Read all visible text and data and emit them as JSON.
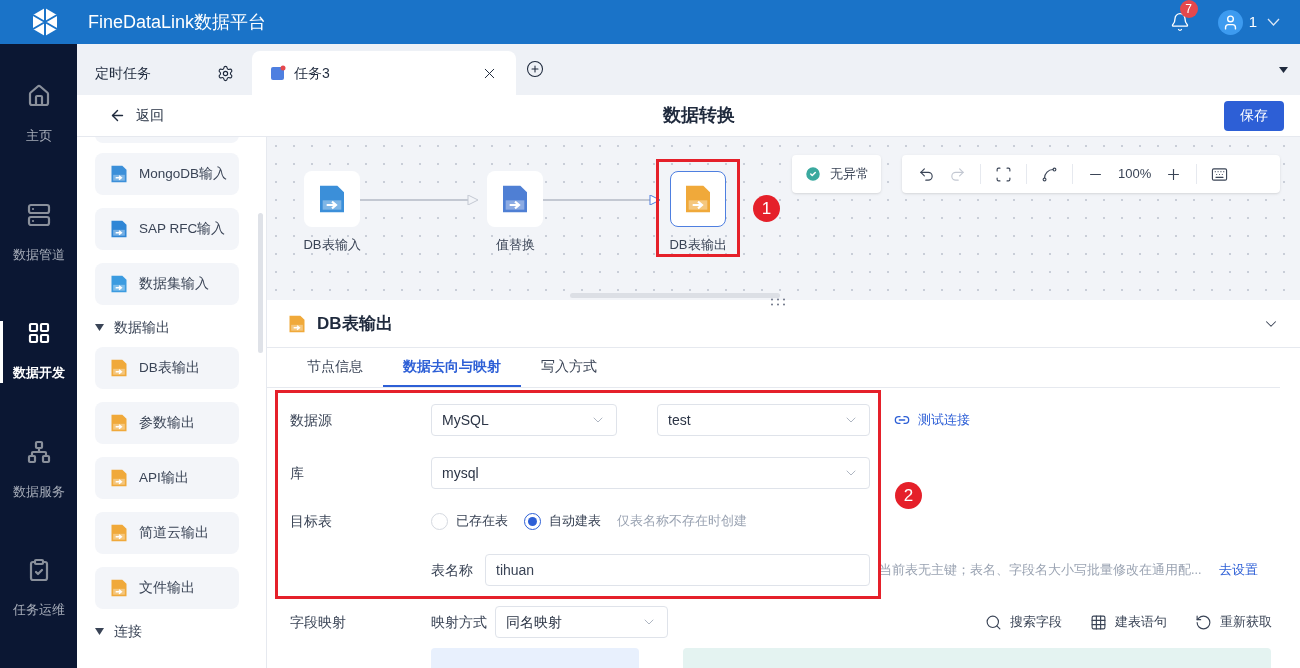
{
  "app": {
    "title": "FineDataLink数据平台",
    "notification_count": "7",
    "user": "1"
  },
  "nav": [
    {
      "label": "主页",
      "selected": false
    },
    {
      "label": "数据管道",
      "selected": false
    },
    {
      "label": "数据开发",
      "selected": true
    },
    {
      "label": "数据服务",
      "selected": false
    },
    {
      "label": "任务运维",
      "selected": false
    }
  ],
  "tabs": [
    {
      "label": "定时任务",
      "selected": false,
      "kind": "settings"
    },
    {
      "label": "任务3",
      "selected": true,
      "kind": "closable"
    }
  ],
  "header": {
    "back": "返回",
    "title": "数据转换",
    "save": "保存"
  },
  "palette": [
    {
      "kind": "item",
      "label": "MongoDB输入"
    },
    {
      "kind": "item",
      "label": "SAP RFC输入"
    },
    {
      "kind": "item",
      "label": "数据集输入"
    },
    {
      "kind": "section",
      "label": "数据输出",
      "expanded": true
    },
    {
      "kind": "item",
      "label": "DB表输出"
    },
    {
      "kind": "item",
      "label": "参数输出"
    },
    {
      "kind": "item",
      "label": "API输出"
    },
    {
      "kind": "item",
      "label": "简道云输出"
    },
    {
      "kind": "item",
      "label": "文件输出"
    },
    {
      "kind": "section",
      "label": "连接",
      "expanded": true
    }
  ],
  "canvas": {
    "nodes": [
      {
        "label": "DB表输入",
        "kind": "dbin",
        "selected": false
      },
      {
        "label": "值替换",
        "kind": "replace",
        "selected": false
      },
      {
        "label": "DB表输出",
        "kind": "dbout",
        "selected": true
      }
    ],
    "status": "无异常",
    "zoom": "100%"
  },
  "annotations": [
    "1",
    "2"
  ],
  "panel": {
    "title": "DB表输出",
    "tabs": [
      {
        "label": "节点信息",
        "selected": false
      },
      {
        "label": "数据去向与映射",
        "selected": true
      },
      {
        "label": "写入方式",
        "selected": false
      }
    ],
    "datasource": {
      "label": "数据源",
      "type": "MySQL",
      "connection": "test",
      "test_link": "测试连接"
    },
    "database": {
      "label": "库",
      "value": "mysql"
    },
    "target": {
      "label": "目标表",
      "options": [
        {
          "label": "已存在表",
          "selected": false
        },
        {
          "label": "自动建表",
          "selected": true
        }
      ],
      "hint": "仅表名称不存在时创建",
      "name_label": "表名称",
      "name_value": "tihuan"
    },
    "notice": "当前表无主键；表名、字段名大小写批量修改在通用配...",
    "notice_link": "去设置",
    "mapping": {
      "label": "字段映射",
      "method_label": "映射方式",
      "method": "同名映射",
      "actions": [
        "搜索字段",
        "建表语句",
        "重新获取"
      ]
    }
  }
}
